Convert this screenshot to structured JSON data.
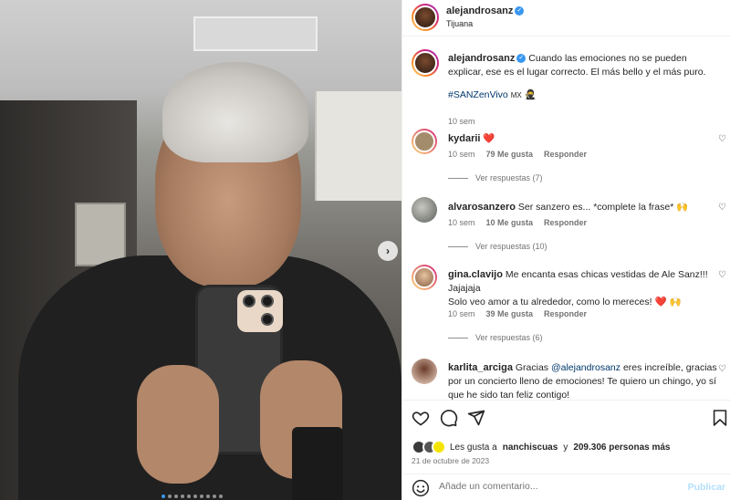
{
  "post": {
    "author": "alejandrosanz",
    "location": "Tijuana",
    "caption_author": "alejandrosanz",
    "caption": "Cuando las emociones no se pueden explicar, ese es el lugar correcto. El más bello y el más puro.",
    "hashtag": "#SANZenVivo",
    "tag_suffix": "MX",
    "caption_time": "10 sem"
  },
  "comments": [
    {
      "user": "kydarii",
      "text": "",
      "emoji": "❤️",
      "time": "10 sem",
      "likes": "79 Me gusta",
      "reply": "Responder",
      "view_replies": "Ver respuestas (7)"
    },
    {
      "user": "alvarosanzero",
      "text": "Ser sanzero es... *complete la frase* 🙌",
      "time": "10 sem",
      "likes": "10 Me gusta",
      "reply": "Responder",
      "view_replies": "Ver respuestas (10)"
    },
    {
      "user": "gina.clavijo",
      "text": "Me encanta esas chicas vestidas de Ale Sanz!!! Jajajaja",
      "text2": "Solo veo amor a tu alrededor, como lo mereces! ❤️ 🙌",
      "time": "10 sem",
      "likes": "39 Me gusta",
      "reply": "Responder",
      "view_replies": "Ver respuestas (6)"
    },
    {
      "user": "karlita_arciga",
      "text_pre": "Gracias",
      "mention": "@alejandrosanz",
      "text_post": "eres increíble, gracias por un concierto lleno de emociones! Te quiero un chingo, yo sí que he sido tan feliz contigo!"
    }
  ],
  "likes": {
    "prefix": "Les gusta a",
    "user": "nanchiscuas",
    "middle": "y",
    "count": "209.306 personas más"
  },
  "date": "21 de octubre de 2023",
  "add_comment": {
    "placeholder": "Añade un comentario...",
    "post_label": "Publicar"
  },
  "icons": {
    "like": "heart-icon",
    "comment": "comment-icon",
    "share": "share-icon",
    "save": "bookmark-icon",
    "emoji": "emoji-icon",
    "next": "chevron-right-icon"
  },
  "colors": {
    "link": "#00376b",
    "verified": "#3897f0",
    "heart": "#ed4956"
  }
}
